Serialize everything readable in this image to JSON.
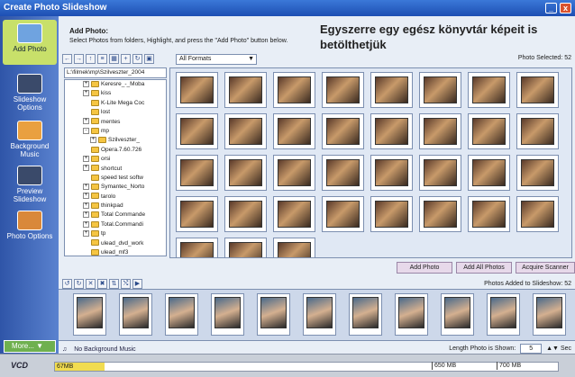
{
  "window": {
    "title": "Create Photo Slideshow",
    "min_icon": "_",
    "close_icon": "x"
  },
  "sidebar": {
    "items": [
      {
        "label": "Add Photo",
        "icon": "add-photo-icon"
      },
      {
        "label": "Slideshow Options",
        "icon": "slideshow-options-icon"
      },
      {
        "label": "Background Music",
        "icon": "music-icon"
      },
      {
        "label": "Preview Slideshow",
        "icon": "preview-icon"
      },
      {
        "label": "Photo Options",
        "icon": "photo-options-icon"
      }
    ],
    "more_label": "More..."
  },
  "header": {
    "title": "Add Photo:",
    "subtitle": "Select Photos from folders, Highlight, and press the \"Add Photo\" button below."
  },
  "overlay_caption": "Egyszerre egy egész könyvtár képeit is betölthetjük",
  "toolbar": {
    "filter_value": "All Formats",
    "selected": "Photo Selected: 52"
  },
  "tree": {
    "path": "L:\\filmek\\mp\\Szilveszter_2004",
    "nodes": [
      {
        "label": "Keresre_-_Moba",
        "toggle": "+"
      },
      {
        "label": "kiss",
        "toggle": "+"
      },
      {
        "label": "K-Lite Mega Coc",
        "toggle": ""
      },
      {
        "label": "lost",
        "toggle": ""
      },
      {
        "label": "mentes",
        "toggle": "+"
      },
      {
        "label": "mp",
        "toggle": "-"
      },
      {
        "label": "Szilveszter_",
        "toggle": "+"
      },
      {
        "label": "Opera.7.60.726",
        "toggle": ""
      },
      {
        "label": "orsi",
        "toggle": "+"
      },
      {
        "label": "shortcut",
        "toggle": "+"
      },
      {
        "label": "speed test softw",
        "toggle": ""
      },
      {
        "label": "Symantec_Norto",
        "toggle": "+"
      },
      {
        "label": "tarolo",
        "toggle": "+"
      },
      {
        "label": "thinkpad",
        "toggle": "+"
      },
      {
        "label": "Total Commande",
        "toggle": "+"
      },
      {
        "label": "Total.Commandi",
        "toggle": "+"
      },
      {
        "label": "tp",
        "toggle": "+"
      },
      {
        "label": "ulead_dvd_work",
        "toggle": ""
      },
      {
        "label": "ulead_mf3",
        "toggle": ""
      }
    ]
  },
  "buttons": {
    "add_photo": "Add Photo",
    "add_all": "Add All Photos",
    "acquire": "Acquire Scanner"
  },
  "strip": {
    "label": "Photos Added to Slideshow: 52"
  },
  "music": {
    "label": "No Background Music"
  },
  "length": {
    "label": "Length Photo is Shown:",
    "value": "5",
    "unit": "Sec"
  },
  "status": {
    "vcd": "VCD",
    "used": "67MB",
    "marks": [
      "650 MB",
      "700 MB"
    ],
    "fill_fraction": 0.098
  }
}
